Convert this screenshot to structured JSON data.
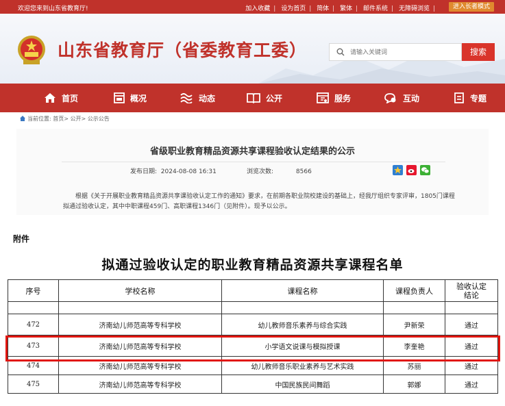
{
  "topbar": {
    "welcome": "欢迎您来到山东省教育厅!",
    "links": [
      "加入收藏",
      "设为首页",
      "简体",
      "繁体",
      "邮件系统",
      "无障碍浏览"
    ],
    "elder_mode": "进入长者模式"
  },
  "header": {
    "site_title": "山东省教育厅（省委教育工委）",
    "search_placeholder": "请输入关键词",
    "search_button": "搜索"
  },
  "nav": {
    "items": [
      {
        "label": "首页",
        "icon": "home-icon"
      },
      {
        "label": "概况",
        "icon": "window-icon"
      },
      {
        "label": "动态",
        "icon": "wave-icon"
      },
      {
        "label": "公开",
        "icon": "book-icon"
      },
      {
        "label": "服务",
        "icon": "service-icon"
      },
      {
        "label": "互动",
        "icon": "chat-icon"
      },
      {
        "label": "专题",
        "icon": "document-icon"
      }
    ]
  },
  "breadcrumb": "当前位置: 首页> 公开> 公示公告",
  "article": {
    "title": "省级职业教育精品资源共享课程验收认定结果的公示",
    "publish_label": "发布日期:",
    "publish_date": "2024-08-08 16:31",
    "views_label": "浏览次数:",
    "views": "8566",
    "intro": "根据《关于开展职业教育精品资源共享课验收认定工作的通知》要求，在前期各职业院校建设的基础上，经我厅组织专家评审，1805门课程拟通过验收认定，其中中职课程459门、高职课程1346门（见附件）。现予以公示。"
  },
  "attachment": {
    "label": "附件",
    "doc_title": "拟通过验收认定的职业教育精品资源共享课程名单",
    "headers": {
      "index": "序号",
      "school": "学校名称",
      "course": "课程名称",
      "lead": "课程负责人",
      "result_line1": "验收认定",
      "result_line2": "结论"
    },
    "rows": [
      {
        "index": "472",
        "school": "济南幼儿师范高等专科学校",
        "course": "幼儿教师音乐素养与综合实践",
        "lead": "尹新荣",
        "result": "通过"
      },
      {
        "index": "473",
        "school": "济南幼儿师范高等专科学校",
        "course": "小学语文说课与模拟授课",
        "lead": "李奎艳",
        "result": "通过"
      },
      {
        "index": "474",
        "school": "济南幼儿师范高等专科学校",
        "course": "幼儿教师音乐职业素养与艺术实践",
        "lead": "苏丽",
        "result": "通过"
      },
      {
        "index": "475",
        "school": "济南幼儿师范高等专科学校",
        "course": "中国民族民间舞蹈",
        "lead": "郭娜",
        "result": "通过"
      }
    ]
  },
  "colors": {
    "brand_red": "#c0322b",
    "highlight_red": "#e1150f",
    "elder_orange": "#e08a2e"
  }
}
